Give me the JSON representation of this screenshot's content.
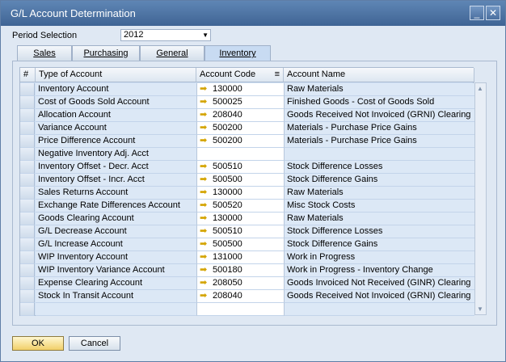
{
  "window": {
    "title": "G/L Account Determination",
    "minimize_icon": "minimize-icon",
    "close_icon": "close-icon"
  },
  "period": {
    "label": "Period Selection",
    "value": "2012"
  },
  "tabs": [
    {
      "label": "Sales"
    },
    {
      "label": "Purchasing"
    },
    {
      "label": "General"
    },
    {
      "label": "Inventory"
    }
  ],
  "grid": {
    "headers": [
      "#",
      "Type of Account",
      "Account Code",
      "Account Name"
    ],
    "rows": [
      {
        "type": "Inventory Account",
        "code": "130000",
        "name": "Raw Materials"
      },
      {
        "type": "Cost of Goods Sold Account",
        "code": "500025",
        "name": "Finished Goods - Cost of Goods Sold"
      },
      {
        "type": "Allocation Account",
        "code": "208040",
        "name": "Goods Received Not Invoiced (GRNI) Clearing"
      },
      {
        "type": "Variance Account",
        "code": "500200",
        "name": "Materials - Purchase Price Gains"
      },
      {
        "type": "Price Difference Account",
        "code": "500200",
        "name": "Materials - Purchase Price Gains"
      },
      {
        "type": "Negative Inventory Adj. Acct",
        "code": "",
        "name": ""
      },
      {
        "type": "Inventory Offset - Decr. Acct",
        "code": "500510",
        "name": "Stock Difference Losses"
      },
      {
        "type": "Inventory Offset - Incr. Acct",
        "code": "500500",
        "name": "Stock Difference Gains"
      },
      {
        "type": "Sales Returns Account",
        "code": "130000",
        "name": "Raw Materials"
      },
      {
        "type": "Exchange Rate Differences Account",
        "code": "500520",
        "name": "Misc Stock Costs"
      },
      {
        "type": "Goods Clearing Account",
        "code": "130000",
        "name": "Raw Materials"
      },
      {
        "type": "G/L Decrease Account",
        "code": "500510",
        "name": "Stock Difference Losses"
      },
      {
        "type": "G/L Increase Account",
        "code": "500500",
        "name": "Stock Difference Gains"
      },
      {
        "type": "WIP Inventory Account",
        "code": "131000",
        "name": "Work in Progress"
      },
      {
        "type": "WIP Inventory Variance Account",
        "code": "500180",
        "name": "Work in Progress - Inventory Change"
      },
      {
        "type": "Expense Clearing Account",
        "code": "208050",
        "name": "Goods Invoiced Not Received (GINR) Clearing"
      },
      {
        "type": "Stock In Transit Account",
        "code": "208040",
        "name": "Goods Received Not Invoiced (GRNI) Clearing"
      },
      {
        "type": "",
        "code": "",
        "name": ""
      }
    ]
  },
  "buttons": {
    "ok": "OK",
    "cancel": "Cancel"
  }
}
